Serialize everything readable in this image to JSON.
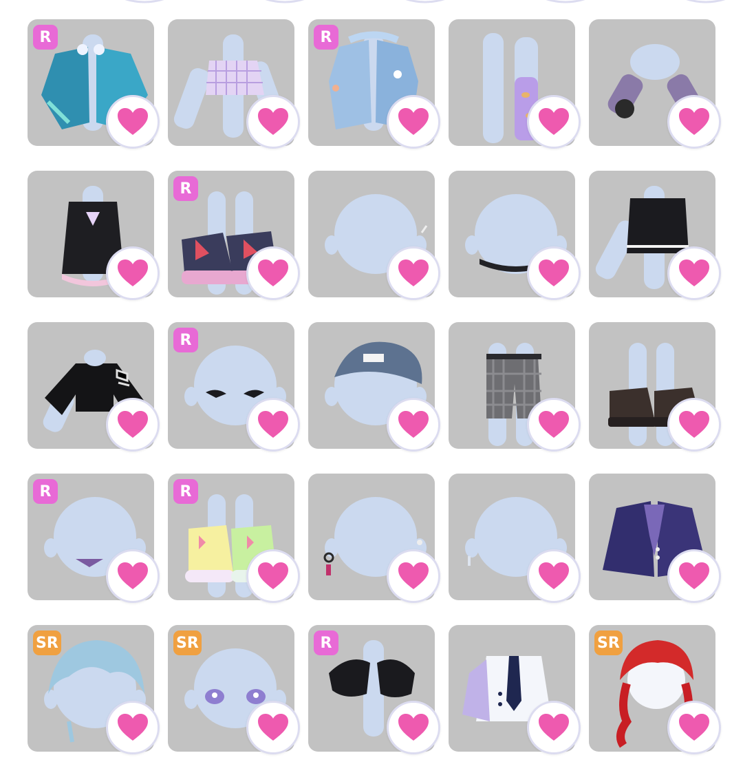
{
  "colors": {
    "tile_bg": "#c2c2c2",
    "heart": "#ee5aaf",
    "badge_R": "#e86ad6",
    "badge_SR": "#f0a040",
    "body_skin": "#cbd9ef"
  },
  "items": [
    {
      "art": "coat-teal-icon",
      "badge": "R"
    },
    {
      "art": "plaid-top-icon",
      "badge": ""
    },
    {
      "art": "blue-jacket-icon",
      "badge": "R"
    },
    {
      "art": "purple-socks-icon",
      "badge": ""
    },
    {
      "art": "striped-sleeves-icon",
      "badge": ""
    },
    {
      "art": "black-dress-icon",
      "badge": ""
    },
    {
      "art": "sneakers-icon",
      "badge": "R"
    },
    {
      "art": "head-blank-icon",
      "badge": ""
    },
    {
      "art": "choker-icon",
      "badge": ""
    },
    {
      "art": "black-tank-icon",
      "badge": ""
    },
    {
      "art": "black-jacket-icon",
      "badge": ""
    },
    {
      "art": "eyes-icon",
      "badge": "R"
    },
    {
      "art": "beret-icon",
      "badge": ""
    },
    {
      "art": "plaid-shorts-icon",
      "badge": ""
    },
    {
      "art": "brown-shoes-icon",
      "badge": ""
    },
    {
      "art": "fang-mouth-icon",
      "badge": "R"
    },
    {
      "art": "pastel-sneakers-icon",
      "badge": "R"
    },
    {
      "art": "earring-icon",
      "badge": ""
    },
    {
      "art": "head-plain-icon",
      "badge": ""
    },
    {
      "art": "navy-blazer-icon",
      "badge": ""
    },
    {
      "art": "blue-hair-icon",
      "badge": "SR"
    },
    {
      "art": "purple-eyes-icon",
      "badge": "SR"
    },
    {
      "art": "fur-shrug-icon",
      "badge": "R"
    },
    {
      "art": "white-shirt-tie-icon",
      "badge": ""
    },
    {
      "art": "red-braids-icon",
      "badge": "SR"
    }
  ]
}
